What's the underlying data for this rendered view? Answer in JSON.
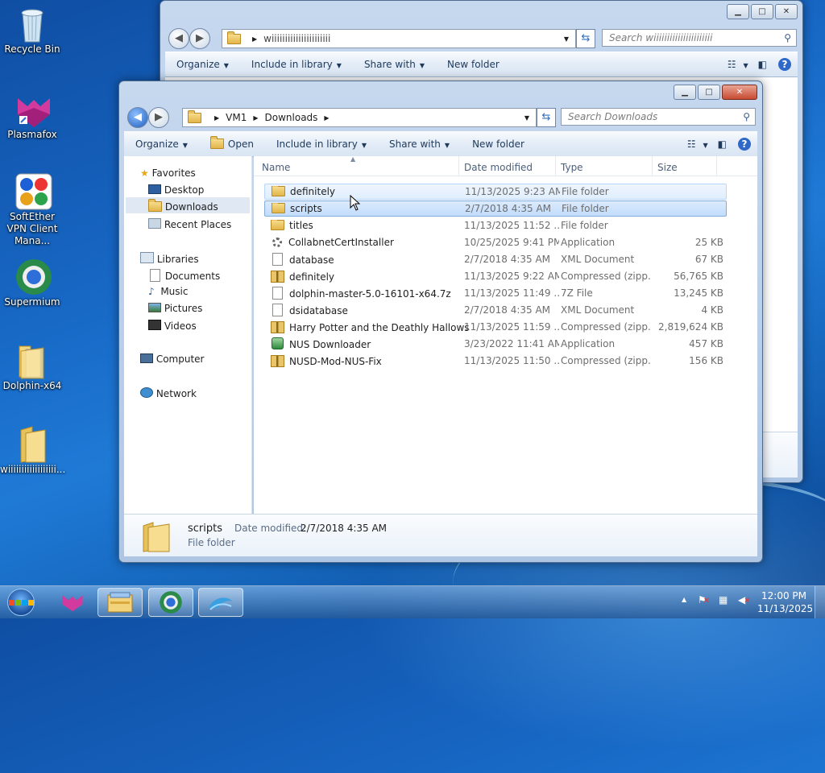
{
  "desktop": {
    "icons": [
      {
        "label": "Recycle Bin"
      },
      {
        "label": "Plasmafox"
      },
      {
        "label": "SoftEther VPN Client Mana..."
      },
      {
        "label": "Supermium"
      },
      {
        "label": "Dolphin-x64"
      },
      {
        "label": "wiiiiiiiiiiiiiiiiii..."
      }
    ]
  },
  "back_window": {
    "address": "wiiiiiiiiiiiiiiiiiiiiii",
    "search_placeholder": "Search wiiiiiiiiiiiiiiiiiiiiii",
    "toolbar": {
      "organize": "Organize",
      "include": "Include in library",
      "share": "Share with",
      "new_folder": "New folder"
    }
  },
  "window": {
    "breadcrumb": [
      "VM1",
      "Downloads"
    ],
    "search_placeholder": "Search Downloads",
    "toolbar": {
      "organize": "Organize",
      "open": "Open",
      "include": "Include in library",
      "share": "Share with",
      "new_folder": "New folder"
    },
    "nav": {
      "favorites": "Favorites",
      "favorites_items": [
        "Desktop",
        "Downloads",
        "Recent Places"
      ],
      "libraries": "Libraries",
      "libraries_items": [
        "Documents",
        "Music",
        "Pictures",
        "Videos"
      ],
      "computer": "Computer",
      "network": "Network"
    },
    "columns": {
      "name": "Name",
      "date": "Date modified",
      "type": "Type",
      "size": "Size"
    },
    "files": [
      {
        "name": "definitely",
        "date": "11/13/2025 9:23 AM",
        "type": "File folder",
        "size": "",
        "icon": "folder"
      },
      {
        "name": "scripts",
        "date": "2/7/2018 4:35 AM",
        "type": "File folder",
        "size": "",
        "icon": "folder"
      },
      {
        "name": "titles",
        "date": "11/13/2025 11:52 ...",
        "type": "File folder",
        "size": "",
        "icon": "folder"
      },
      {
        "name": "CollabnetCertInstaller",
        "date": "10/25/2025 9:41 PM",
        "type": "Application",
        "size": "25 KB",
        "icon": "gear"
      },
      {
        "name": "database",
        "date": "2/7/2018 4:35 AM",
        "type": "XML Document",
        "size": "67 KB",
        "icon": "file"
      },
      {
        "name": "definitely",
        "date": "11/13/2025 9:22 AM",
        "type": "Compressed (zipp...",
        "size": "56,765 KB",
        "icon": "zip"
      },
      {
        "name": "dolphin-master-5.0-16101-x64.7z",
        "date": "11/13/2025 11:49 ...",
        "type": "7Z File",
        "size": "13,245 KB",
        "icon": "file"
      },
      {
        "name": "dsidatabase",
        "date": "2/7/2018 4:35 AM",
        "type": "XML Document",
        "size": "4 KB",
        "icon": "file"
      },
      {
        "name": "Harry Potter and the Deathly Hallows - P...",
        "date": "11/13/2025 11:59 ...",
        "type": "Compressed (zipp...",
        "size": "2,819,624 KB",
        "icon": "zip"
      },
      {
        "name": "NUS Downloader",
        "date": "3/23/2022 11:41 AM",
        "type": "Application",
        "size": "457 KB",
        "icon": "app"
      },
      {
        "name": "NUSD-Mod-NUS-Fix",
        "date": "11/13/2025 11:50 ...",
        "type": "Compressed (zipp...",
        "size": "156 KB",
        "icon": "zip"
      }
    ],
    "details": {
      "name": "scripts",
      "date_label": "Date modified:",
      "date_value": "2/7/2018 4:35 AM",
      "type": "File folder"
    }
  },
  "taskbar": {
    "time": "12:00 PM",
    "date": "11/13/2025"
  }
}
